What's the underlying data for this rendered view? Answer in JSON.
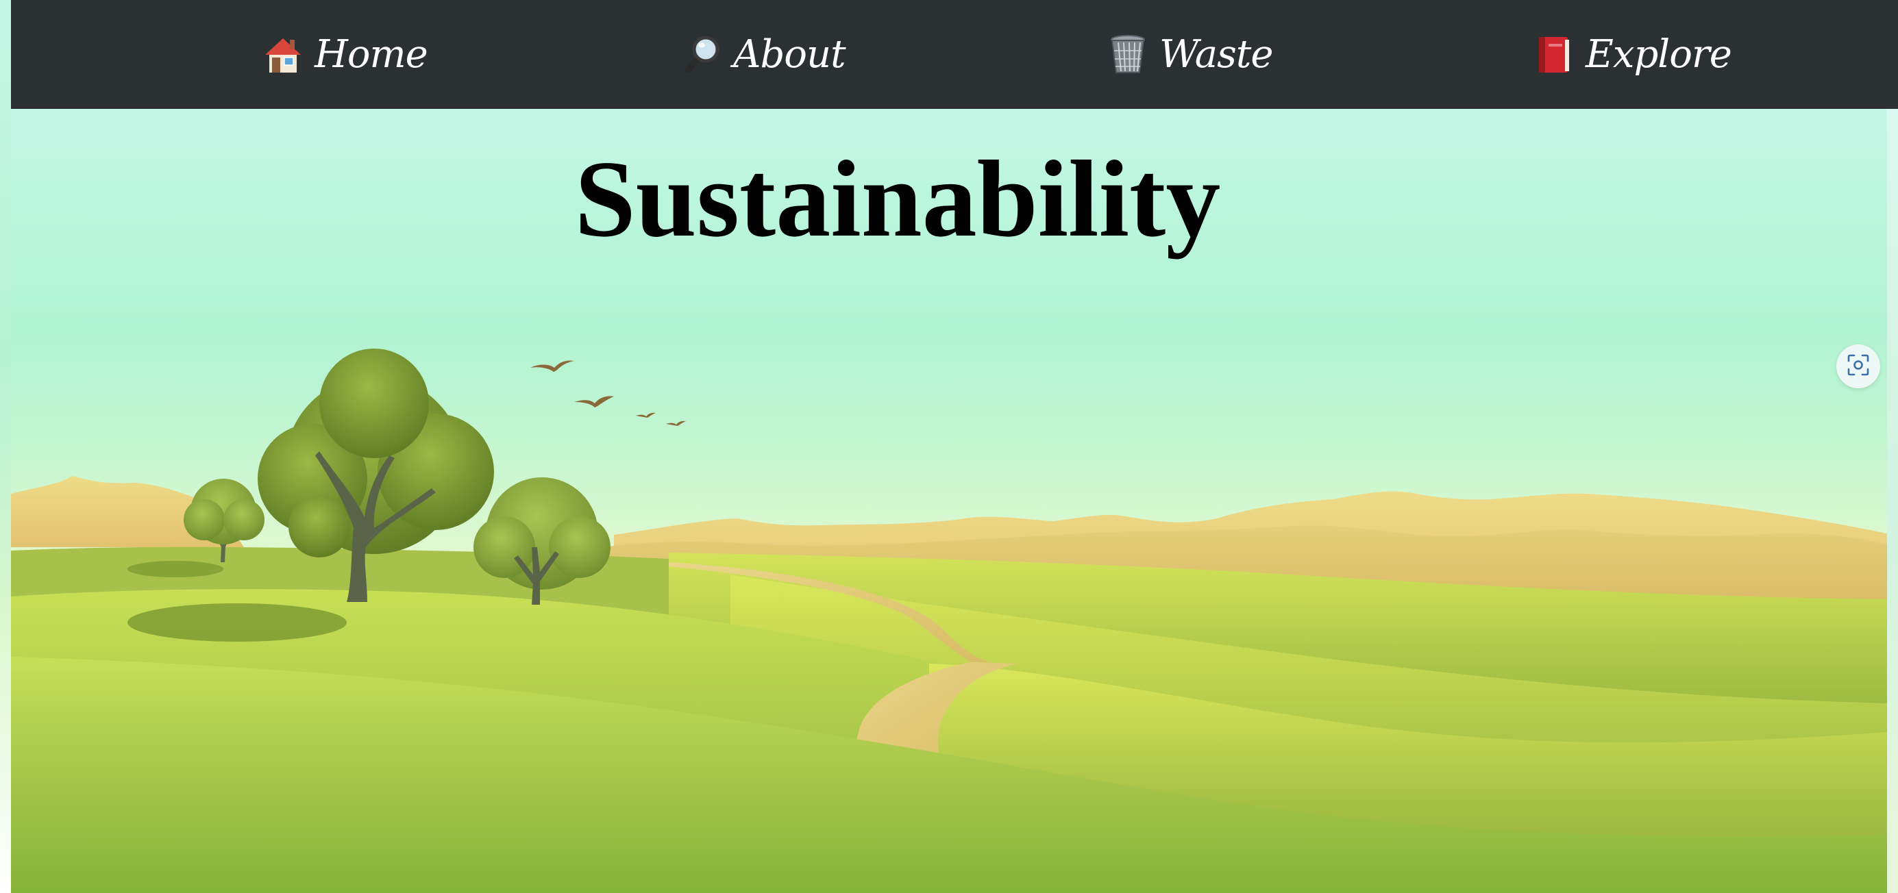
{
  "nav": {
    "items": [
      {
        "icon": "house-icon",
        "label": "Home"
      },
      {
        "icon": "magnifier-icon",
        "label": "About"
      },
      {
        "icon": "wastebasket-icon",
        "label": "Waste"
      },
      {
        "icon": "red-book-icon",
        "label": "Explore"
      }
    ]
  },
  "main": {
    "title": "Sustainability"
  },
  "floating_button": {
    "icon": "screenshot-capture-icon"
  },
  "colors": {
    "nav_background": "#2b3132",
    "nav_text": "#ffffff",
    "sky_top": "#c4f7e6",
    "grass": "#9cc548",
    "hills": "#e6cf78"
  }
}
